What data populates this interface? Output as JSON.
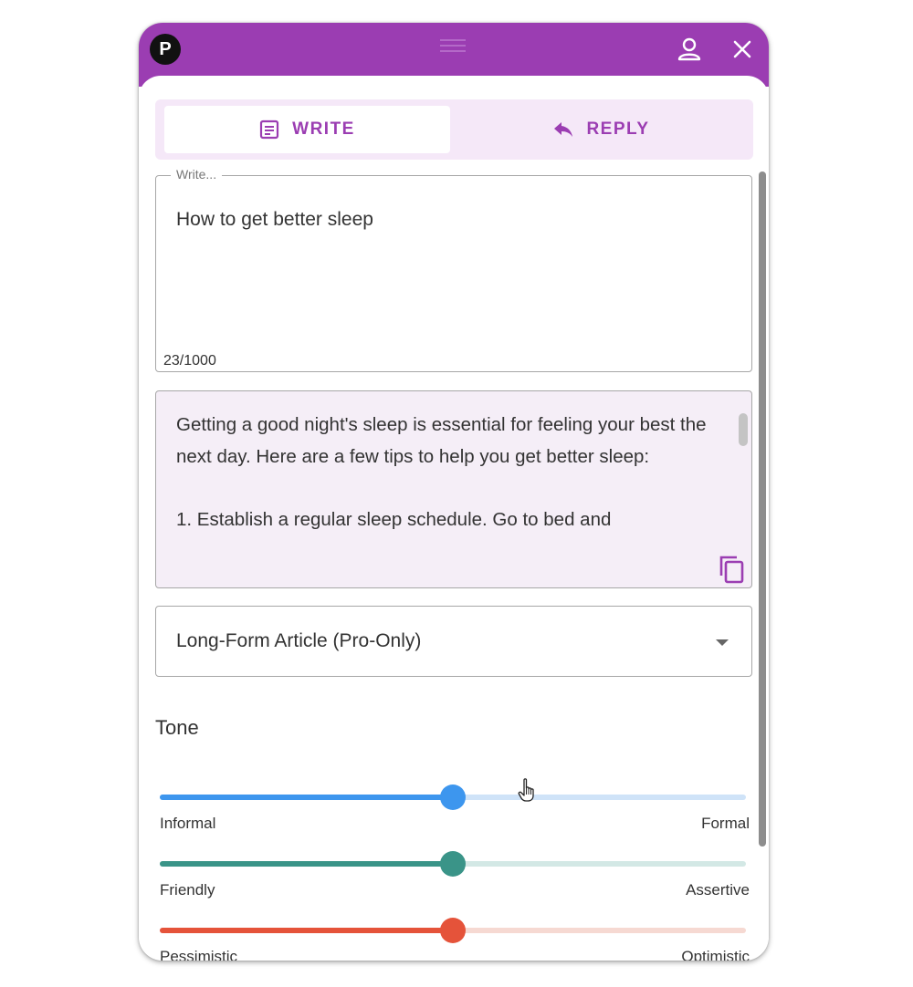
{
  "window": {
    "logo_text": "P"
  },
  "tabs": [
    {
      "label": "WRITE",
      "icon": "note-icon",
      "active": true
    },
    {
      "label": "REPLY",
      "icon": "reply-arrow-icon",
      "active": false
    }
  ],
  "write": {
    "label": "Write...",
    "value": "How to get better sleep",
    "char_count": "23/1000"
  },
  "output": {
    "text": "Getting a good night's sleep is essential for feeling your best the next day. Here are a few tips to help you get better sleep:\n\n1. Establish a regular sleep schedule. Go to bed and"
  },
  "format_select": {
    "value": "Long-Form Article (Pro-Only)"
  },
  "tone": {
    "label": "Tone",
    "sliders": [
      {
        "left_label": "Informal",
        "right_label": "Formal",
        "value": 0.5,
        "color": "#3d96ee",
        "track_color": "#cfe3f8"
      },
      {
        "left_label": "Friendly",
        "right_label": "Assertive",
        "value": 0.5,
        "color": "#3a9488",
        "track_color": "#d3e8e5"
      },
      {
        "left_label": "Pessimistic",
        "right_label": "Optimistic",
        "value": 0.5,
        "color": "#e5533a",
        "track_color": "#f6d9d2"
      }
    ]
  },
  "colors": {
    "accent": "#9b3db2",
    "tab_bg": "#f5e8f8",
    "output_bg": "#f5eef7"
  }
}
